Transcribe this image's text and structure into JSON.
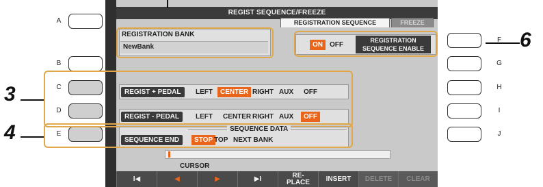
{
  "screen": {
    "title": "REGIST SEQUENCE/FREEZE",
    "tabs": [
      {
        "label": "REGISTRATION SEQUENCE",
        "active": true
      },
      {
        "label": "FREEZE",
        "active": false
      }
    ]
  },
  "side_buttons": {
    "left": [
      "A",
      "B",
      "C",
      "D",
      "E"
    ],
    "right": [
      "F",
      "G",
      "H",
      "I",
      "J"
    ]
  },
  "callouts": [
    "3",
    "4",
    "6"
  ],
  "bank": {
    "header": "REGISTRATION BANK",
    "name": "NewBank"
  },
  "enable": {
    "on_label": "ON",
    "off_label": "OFF",
    "label_line1": "REGISTRATION",
    "label_line2": "SEQUENCE ENABLE",
    "state": "ON"
  },
  "pedal_plus": {
    "label": "REGIST + PEDAL",
    "options": [
      "LEFT",
      "CENTER",
      "RIGHT",
      "AUX",
      "OFF"
    ],
    "selected": "CENTER"
  },
  "pedal_minus": {
    "label": "REGIST - PEDAL",
    "options": [
      "LEFT",
      "CENTER",
      "RIGHT",
      "AUX",
      "OFF"
    ],
    "selected": "OFF"
  },
  "sequence_data": {
    "title": "SEQUENCE DATA",
    "end_label": "SEQUENCE END",
    "options": [
      "STOP",
      "TOP",
      "NEXT BANK"
    ],
    "selected": "STOP"
  },
  "cursor_label": "CURSOR",
  "function_row": {
    "first": "I◀",
    "prev": "◀",
    "next": "▶",
    "last": "▶I",
    "replace_line1": "RE-",
    "replace_line2": "PLACE",
    "insert": "INSERT",
    "delete": "DELETE",
    "clear": "CLEAR"
  },
  "colors": {
    "accent": "#e8651b",
    "highlight": "#e0a84a",
    "label_bar": "#3a3a3a",
    "screen_bg": "#c9c9c9"
  }
}
